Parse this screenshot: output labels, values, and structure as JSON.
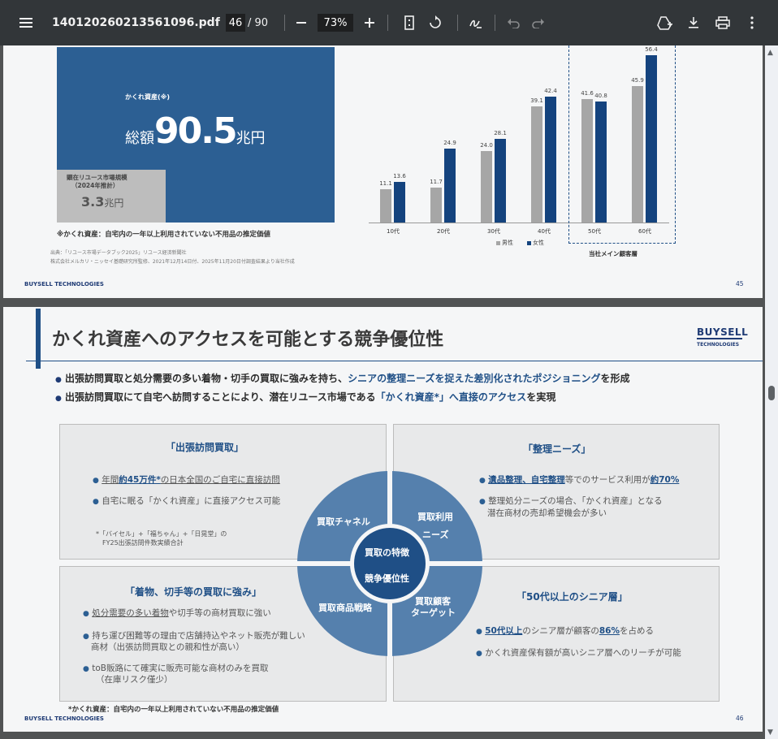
{
  "toolbar": {
    "filename": "140120260213561096.pdf",
    "page": "46",
    "total": "/ 90",
    "zoom": "73%"
  },
  "page45": {
    "kakure_label": "かくれ資産(※)",
    "sogaku": "総額",
    "big_value": "90.5",
    "big_unit": "兆円",
    "reuse_label": "顕在リユース市場規模",
    "reuse_sub": "（2024年推計）",
    "reuse_value": "3.3",
    "reuse_unit": "兆円",
    "note": "※かくれ資産：自宅内の一年以上利用されていない不用品の推定価値",
    "source1": "出典：「リユース市場データブック2025」リユース経済新聞社",
    "source2": "株式会社メルカリ・ニッセイ基礎研究所監修、2021年12月14日付、2025年11月20日付調査結果より当社作成",
    "footer": "BUYSELL TECHNOLOGIES",
    "page_num": "45",
    "main_layer": "当社メイン顧客層"
  },
  "chart_data": {
    "type": "bar",
    "categories": [
      "10代",
      "20代",
      "30代",
      "40代",
      "50代",
      "60代"
    ],
    "series": [
      {
        "name": "男性",
        "color": "#a6a6a6",
        "values": [
          11.1,
          11.7,
          24.0,
          39.1,
          41.6,
          45.9
        ]
      },
      {
        "name": "女性",
        "color": "#14437e",
        "values": [
          13.6,
          24.9,
          28.1,
          42.4,
          40.8,
          56.4
        ]
      }
    ],
    "labels_male": [
      "11.1",
      "11.7",
      "24.0",
      "39.1",
      "41.6",
      "45.9"
    ],
    "labels_female": [
      "13.6",
      "24.9",
      "28.1",
      "42.4",
      "40.8",
      "56.4"
    ],
    "legend": [
      "男性",
      "女性"
    ]
  },
  "page46": {
    "title": "かくれ資産へのアクセスを可能とする競争優位性",
    "logo_top": "BUYSELL",
    "logo_bottom": "TECHNOLOGIES",
    "b1_a": "出張訪問買取と処分需要の多い着物・切手の買取に強みを持ち、",
    "b1_b": "シニアの整理ニーズを捉えた差別化されたポジショニング",
    "b1_c": "を形成",
    "b2_a": "出張訪問買取にて自宅へ訪問することにより、潜在リユース市場である",
    "b2_b": "「かくれ資産*」へ直接のアクセス",
    "b2_c": "を実現",
    "q1_title": "「出張訪問買取」",
    "q1_i1_a": "年間",
    "q1_i1_b": "約45万件*",
    "q1_i1_c": "の日本全国のご自宅に直接訪問",
    "q1_i2": "自宅に眠る「かくれ資産」に直接アクセス可能",
    "q1_note1": "*「バイセル」+「福ちゃん」+「日晃堂」の",
    "q1_note2": "FY25出張訪問件数実績合計",
    "q2_title": "「整理ニーズ」",
    "q2_i1_a": "遺品整理、自宅整理",
    "q2_i1_b": "等でのサービス利用が",
    "q2_i1_c": "約70%",
    "q2_i2a": "整理処分ニーズの場合、「かくれ資産」となる",
    "q2_i2b": "潜在商材の売却希望機会が多い",
    "q3_title": "「着物、切手等の買取に強み」",
    "q3_i1_a": "処分需要の多い着物",
    "q3_i1_b": "や切手等の商材買取に強い",
    "q3_i2a": "持ち運び困難等の理由で店舗持込やネット販売が難しい",
    "q3_i2b": "商材（出張訪問買取との親和性が高い）",
    "q3_i3a": "toB販路にて確実に販売可能な商材のみを買取",
    "q3_i3b": "（在庫リスク僅少）",
    "q4_title": "「50代以上のシニア層」",
    "q4_i1_a": "50代以上",
    "q4_i1_b": "のシニア層が顧客の",
    "q4_i1_c": "86%",
    "q4_i1_d": "を占める",
    "q4_i2": "かくれ資産保有額が高いシニア層へのリーチが可能",
    "c_tl": "買取チャネル",
    "c_tr1": "買取利用",
    "c_tr2": "ニーズ",
    "c_bl": "買取商品戦略",
    "c_br1": "買取顧客",
    "c_br2": "ターゲット",
    "c_center1": "買取の特徴",
    "c_center2": "競争優位性",
    "note": "*かくれ資産：自宅内の一年以上利用されていない不用品の推定価値",
    "footer": "BUYSELL TECHNOLOGIES",
    "page_num": "46"
  }
}
